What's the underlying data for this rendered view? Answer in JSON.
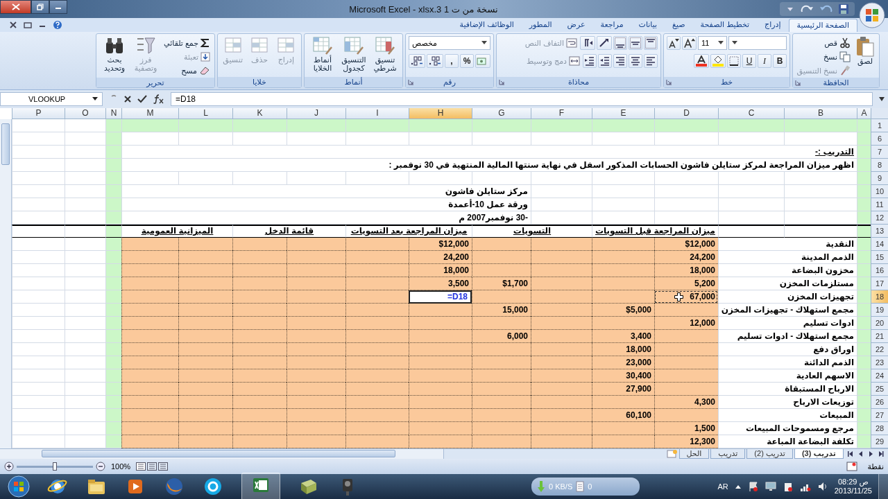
{
  "window": {
    "title": "Microsoft Excel - xlsx.3 1 نسخة من ت"
  },
  "tabs": [
    {
      "label": "الصفحة الرئيسية",
      "selected": true
    },
    {
      "label": "إدراج",
      "selected": false
    },
    {
      "label": "تخطيط الصفحة",
      "selected": false
    },
    {
      "label": "صيغ",
      "selected": false
    },
    {
      "label": "بيانات",
      "selected": false
    },
    {
      "label": "مراجعة",
      "selected": false
    },
    {
      "label": "عرض",
      "selected": false
    },
    {
      "label": "المطور",
      "selected": false
    },
    {
      "label": "الوظائف الإضافية",
      "selected": false
    }
  ],
  "ribbon": [
    {
      "kind": "clipboard",
      "label": "الحافظة",
      "buttons": [
        {
          "label": "لصق",
          "disabled": false
        },
        {
          "label": "قص",
          "disabled": false
        },
        {
          "label": "نسخ",
          "disabled": false
        },
        {
          "label": "نسخ التنسيق",
          "disabled": true
        }
      ]
    },
    {
      "kind": "font",
      "label": "خط",
      "font_size": "11",
      "styles": [
        "B",
        "I",
        "U"
      ]
    },
    {
      "kind": "alignment",
      "label": "محاذاة",
      "buttons": [
        {
          "label": "التفاف النص",
          "disabled": true
        },
        {
          "label": "دمج وتوسيط",
          "disabled": true
        }
      ]
    },
    {
      "kind": "number",
      "label": "رقم",
      "format": "مخصص",
      "symbols": [
        "%",
        ","
      ]
    },
    {
      "kind": "styles",
      "label": "أنماط",
      "buttons": [
        {
          "label": "تنسيق شرطي",
          "disabled": false
        },
        {
          "label": "التنسيق كجدول",
          "disabled": false
        },
        {
          "label": "أنماط الخلايا",
          "disabled": false
        }
      ]
    },
    {
      "kind": "cells",
      "label": "خلايا",
      "buttons": [
        {
          "label": "إدراج",
          "disabled": true
        },
        {
          "label": "حذف",
          "disabled": true
        },
        {
          "label": "تنسيق",
          "disabled": true
        }
      ]
    },
    {
      "kind": "editing",
      "label": "تحرير",
      "buttons": [
        {
          "label": "جمع تلقائي",
          "disabled": false
        },
        {
          "label": "تعبئة",
          "disabled": true
        },
        {
          "label": "مسح",
          "disabled": false
        },
        {
          "label": "فرز وتصفية",
          "disabled": true
        },
        {
          "label": "بحث وتحديد",
          "disabled": false
        }
      ]
    }
  ],
  "formula_bar": {
    "name_box": "VLOOKUP",
    "formula": "=D18"
  },
  "sheet": {
    "columns": [
      {
        "label": "A",
        "selected": false
      },
      {
        "label": "B",
        "selected": false
      },
      {
        "label": "C",
        "selected": false
      },
      {
        "label": "D",
        "selected": false
      },
      {
        "label": "E",
        "selected": false
      },
      {
        "label": "F",
        "selected": false
      },
      {
        "label": "G",
        "selected": false
      },
      {
        "label": "H",
        "selected": true
      },
      {
        "label": "I",
        "selected": false
      },
      {
        "label": "J",
        "selected": false
      },
      {
        "label": "K",
        "selected": false
      },
      {
        "label": "L",
        "selected": false
      },
      {
        "label": "M",
        "selected": false
      },
      {
        "label": "N",
        "selected": false
      },
      {
        "label": "O",
        "selected": false
      },
      {
        "label": "P",
        "selected": false
      }
    ],
    "rows": [
      {
        "number": "1",
        "kind": "plain",
        "selected": false,
        "cells": [
          "",
          "",
          "",
          "",
          "",
          "",
          "",
          "",
          "",
          "",
          "",
          "",
          "",
          "",
          "",
          ""
        ]
      },
      {
        "number": "6",
        "kind": "plain",
        "selected": false,
        "cells": [
          "",
          "",
          "",
          "",
          "",
          "",
          "",
          "",
          "",
          "",
          "",
          "",
          "",
          "",
          "",
          ""
        ]
      },
      {
        "number": "7",
        "kind": "plain",
        "selected": false,
        "cells": [
          "",
          {
            "text": "التدريب :-",
            "kind": "caption",
            "selected": false,
            "copied": false
          },
          "",
          "",
          "",
          "",
          "",
          "",
          "",
          "",
          "",
          "",
          "",
          "",
          "",
          ""
        ]
      },
      {
        "number": "8",
        "kind": "plain",
        "selected": false,
        "cells": [
          "",
          {
            "text": "اظهر ميزان المراجعة لمركز ستايلن فاشون الحسابات المذكور اسفل في نهاية سنتها المالية المنتهية في 30 نوفمبر :",
            "kind": "text",
            "selected": false,
            "copied": false
          },
          "",
          "",
          "",
          "",
          "",
          "",
          "",
          "",
          "",
          "",
          "",
          "",
          "",
          ""
        ]
      },
      {
        "number": "9",
        "kind": "plain",
        "selected": false,
        "cells": [
          "",
          "",
          "",
          "",
          "",
          "",
          "",
          "",
          "",
          "",
          "",
          "",
          "",
          "",
          "",
          ""
        ]
      },
      {
        "number": "10",
        "kind": "plain",
        "selected": false,
        "cells": [
          "",
          "",
          "",
          "",
          "",
          "",
          {
            "text": "مركز ستايلن فاشون",
            "kind": "text",
            "selected": false,
            "copied": false
          },
          "",
          "",
          "",
          "",
          "",
          "",
          "",
          "",
          ""
        ]
      },
      {
        "number": "11",
        "kind": "plain",
        "selected": false,
        "cells": [
          "",
          "",
          "",
          "",
          "",
          "",
          {
            "text": "ورقة عمل 10-أعمدة",
            "kind": "text",
            "selected": false,
            "copied": false
          },
          "",
          "",
          "",
          "",
          "",
          "",
          "",
          "",
          ""
        ]
      },
      {
        "number": "12",
        "kind": "plain",
        "selected": false,
        "cells": [
          "",
          "",
          "",
          "",
          "",
          "",
          {
            "text": "-30 نوفمبر2007 م",
            "kind": "text",
            "selected": false,
            "copied": false
          },
          "",
          "",
          "",
          "",
          "",
          "",
          "",
          "",
          ""
        ]
      },
      {
        "number": "13",
        "kind": "header",
        "selected": false,
        "cells": [
          "",
          "",
          "",
          {
            "text": "ميزان المراجعة قبل التسويات",
            "kind": "heading",
            "selected": false,
            "copied": false
          },
          "",
          {
            "text": "التسويات",
            "kind": "heading",
            "selected": false,
            "copied": false
          },
          "",
          {
            "text": "ميزان المراجعة بعد التسويات",
            "kind": "heading",
            "selected": false,
            "copied": false
          },
          "",
          {
            "text": "قائمة الدخل",
            "kind": "heading",
            "selected": false,
            "copied": false
          },
          "",
          {
            "text": "الميزانية العمومية",
            "kind": "heading",
            "selected": false,
            "copied": false
          },
          "",
          "",
          "",
          ""
        ]
      },
      {
        "number": "14",
        "kind": "plain",
        "selected": false,
        "cells": [
          "",
          {
            "text": "النقدية",
            "kind": "label",
            "selected": false,
            "copied": false
          },
          "",
          {
            "text": "$12,000",
            "kind": "number",
            "selected": false,
            "copied": false
          },
          "",
          "",
          "",
          {
            "text": "$12,000",
            "kind": "number",
            "selected": false,
            "copied": false
          },
          "",
          "",
          "",
          "",
          "",
          "",
          "",
          ""
        ]
      },
      {
        "number": "15",
        "kind": "plain",
        "selected": false,
        "cells": [
          "",
          {
            "text": "الذمم المدينة",
            "kind": "label",
            "selected": false,
            "copied": false
          },
          "",
          {
            "text": "24,200",
            "kind": "number",
            "selected": false,
            "copied": false
          },
          "",
          "",
          "",
          {
            "text": "24,200",
            "kind": "number",
            "selected": false,
            "copied": false
          },
          "",
          "",
          "",
          "",
          "",
          "",
          "",
          ""
        ]
      },
      {
        "number": "16",
        "kind": "plain",
        "selected": false,
        "cells": [
          "",
          {
            "text": "مخزون البضاعة",
            "kind": "label",
            "selected": false,
            "copied": false
          },
          "",
          {
            "text": "18,000",
            "kind": "number",
            "selected": false,
            "copied": false
          },
          "",
          "",
          "",
          {
            "text": "18,000",
            "kind": "number",
            "selected": false,
            "copied": false
          },
          "",
          "",
          "",
          "",
          "",
          "",
          "",
          ""
        ]
      },
      {
        "number": "17",
        "kind": "plain",
        "selected": false,
        "cells": [
          "",
          {
            "text": "مستلزمات المخزن",
            "kind": "label",
            "selected": false,
            "copied": false
          },
          "",
          {
            "text": "5,200",
            "kind": "number",
            "selected": false,
            "copied": false
          },
          "",
          "",
          {
            "text": "$1,700",
            "kind": "number",
            "selected": false,
            "copied": false
          },
          {
            "text": "3,500",
            "kind": "number",
            "selected": false,
            "copied": false
          },
          "",
          "",
          "",
          "",
          "",
          "",
          "",
          ""
        ]
      },
      {
        "number": "18",
        "kind": "plain",
        "selected": true,
        "cells": [
          "",
          {
            "text": "تجهيزات المخزن",
            "kind": "label",
            "selected": false,
            "copied": false
          },
          "",
          {
            "text": "67,000",
            "kind": "number",
            "selected": false,
            "copied": true
          },
          "",
          "",
          "",
          {
            "text": "=D18",
            "kind": "formula",
            "selected": true,
            "copied": false
          },
          "",
          "",
          "",
          "",
          "",
          "",
          "",
          ""
        ]
      },
      {
        "number": "19",
        "kind": "plain",
        "selected": false,
        "cells": [
          "",
          {
            "text": "مجمع استهلاك - تجهيزات المخزن",
            "kind": "label",
            "selected": false,
            "copied": false
          },
          "",
          "",
          {
            "text": "$5,000",
            "kind": "number",
            "selected": false,
            "copied": false
          },
          "",
          {
            "text": "15,000",
            "kind": "number",
            "selected": false,
            "copied": false
          },
          "",
          "",
          "",
          "",
          "",
          "",
          "",
          "",
          ""
        ]
      },
      {
        "number": "20",
        "kind": "plain",
        "selected": false,
        "cells": [
          "",
          {
            "text": "ادوات تسليم",
            "kind": "label",
            "selected": false,
            "copied": false
          },
          "",
          {
            "text": "12,000",
            "kind": "number",
            "selected": false,
            "copied": false
          },
          "",
          "",
          "",
          "",
          "",
          "",
          "",
          "",
          "",
          "",
          "",
          ""
        ]
      },
      {
        "number": "21",
        "kind": "plain",
        "selected": false,
        "cells": [
          "",
          {
            "text": "مجمع استهلاك - ادوات تسليم",
            "kind": "label",
            "selected": false,
            "copied": false
          },
          "",
          "",
          {
            "text": "3,400",
            "kind": "number",
            "selected": false,
            "copied": false
          },
          "",
          {
            "text": "6,000",
            "kind": "number",
            "selected": false,
            "copied": false
          },
          "",
          "",
          "",
          "",
          "",
          "",
          "",
          "",
          ""
        ]
      },
      {
        "number": "22",
        "kind": "plain",
        "selected": false,
        "cells": [
          "",
          {
            "text": "اوراق دفع",
            "kind": "label",
            "selected": false,
            "copied": false
          },
          "",
          "",
          {
            "text": "18,000",
            "kind": "number",
            "selected": false,
            "copied": false
          },
          "",
          "",
          "",
          "",
          "",
          "",
          "",
          "",
          "",
          "",
          ""
        ]
      },
      {
        "number": "23",
        "kind": "plain",
        "selected": false,
        "cells": [
          "",
          {
            "text": "الذمم الدائنة",
            "kind": "label",
            "selected": false,
            "copied": false
          },
          "",
          "",
          {
            "text": "23,000",
            "kind": "number",
            "selected": false,
            "copied": false
          },
          "",
          "",
          "",
          "",
          "",
          "",
          "",
          "",
          "",
          "",
          ""
        ]
      },
      {
        "number": "24",
        "kind": "plain",
        "selected": false,
        "cells": [
          "",
          {
            "text": "الاسهم العادية",
            "kind": "label",
            "selected": false,
            "copied": false
          },
          "",
          "",
          {
            "text": "30,400",
            "kind": "number",
            "selected": false,
            "copied": false
          },
          "",
          "",
          "",
          "",
          "",
          "",
          "",
          "",
          "",
          "",
          ""
        ]
      },
      {
        "number": "25",
        "kind": "plain",
        "selected": false,
        "cells": [
          "",
          {
            "text": "الارباح المستبقاة",
            "kind": "label",
            "selected": false,
            "copied": false
          },
          "",
          "",
          {
            "text": "27,900",
            "kind": "number",
            "selected": false,
            "copied": false
          },
          "",
          "",
          "",
          "",
          "",
          "",
          "",
          "",
          "",
          "",
          ""
        ]
      },
      {
        "number": "26",
        "kind": "plain",
        "selected": false,
        "cells": [
          "",
          {
            "text": "توزيعات الارباح",
            "kind": "label",
            "selected": false,
            "copied": false
          },
          "",
          {
            "text": "4,300",
            "kind": "number",
            "selected": false,
            "copied": false
          },
          "",
          "",
          "",
          "",
          "",
          "",
          "",
          "",
          "",
          "",
          "",
          ""
        ]
      },
      {
        "number": "27",
        "kind": "plain",
        "selected": false,
        "cells": [
          "",
          {
            "text": "المبيعات",
            "kind": "label",
            "selected": false,
            "copied": false
          },
          "",
          "",
          {
            "text": "60,100",
            "kind": "number",
            "selected": false,
            "copied": false
          },
          "",
          "",
          "",
          "",
          "",
          "",
          "",
          "",
          "",
          "",
          ""
        ]
      },
      {
        "number": "28",
        "kind": "plain",
        "selected": false,
        "cells": [
          "",
          {
            "text": "مرجع ومسموحات المبيعات",
            "kind": "label",
            "selected": false,
            "copied": false
          },
          "",
          {
            "text": "1,500",
            "kind": "number",
            "selected": false,
            "copied": false
          },
          "",
          "",
          "",
          "",
          "",
          "",
          "",
          "",
          "",
          "",
          "",
          ""
        ]
      },
      {
        "number": "29",
        "kind": "plain",
        "selected": false,
        "cells": [
          "",
          {
            "text": "تكلفة البضاعة المباعة",
            "kind": "label",
            "selected": false,
            "copied": false
          },
          "",
          {
            "text": "12,300",
            "kind": "number",
            "selected": false,
            "copied": false
          },
          "",
          "",
          "",
          "",
          "",
          "",
          "",
          "",
          "",
          "",
          "",
          ""
        ]
      }
    ]
  },
  "sheet_tabs": [
    {
      "label": "تدريب (3)",
      "selected": true
    },
    {
      "label": "تدريب (2)",
      "selected": false
    },
    {
      "label": "تدريب",
      "selected": false
    },
    {
      "label": "الحل",
      "selected": false
    }
  ],
  "status_bar": {
    "mode": "نقطة",
    "zoom": "100%",
    "zoom_slider": {
      "level": 0.5
    }
  },
  "taskbar": {
    "network_speed": "0 KB/S",
    "network_count": "0",
    "language": "AR",
    "time": "ص 08:29",
    "date": "2013/11/25"
  }
}
